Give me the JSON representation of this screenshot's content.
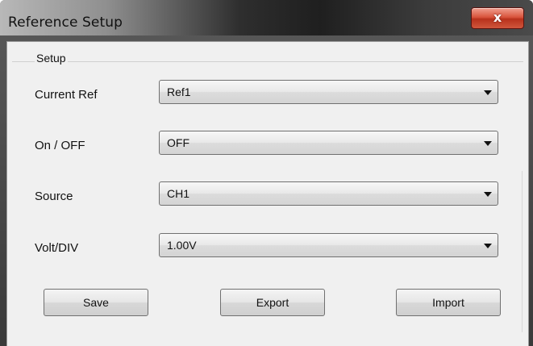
{
  "window": {
    "title": "Reference Setup",
    "close_glyph": "x"
  },
  "group": {
    "label": "Setup"
  },
  "rows": [
    {
      "label": "Current Ref",
      "value": "Ref1"
    },
    {
      "label": "On / OFF",
      "value": "OFF"
    },
    {
      "label": "Source",
      "value": "CH1"
    },
    {
      "label": "Volt/DIV",
      "value": "1.00V"
    }
  ],
  "buttons": {
    "save": "Save",
    "export": "Export",
    "import": "Import"
  },
  "colors": {
    "close_button": "#d9543c",
    "dialog_background": "#f0f0f0"
  },
  "icons": {
    "close": "close-icon",
    "dropdown": "chevron-down-icon"
  }
}
